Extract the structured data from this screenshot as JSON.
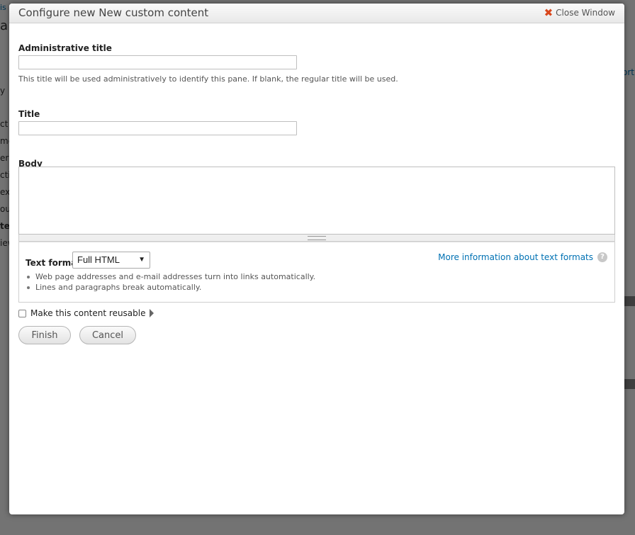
{
  "background": {
    "fragments": [
      "is",
      "a",
      "ort",
      "y",
      "ct",
      "me",
      "era",
      "cti",
      "ex",
      "out",
      "ter",
      "iew"
    ]
  },
  "modal": {
    "title": "Configure new New custom content",
    "close_label": "Close Window",
    "admin_title": {
      "label": "Administrative title",
      "value": "",
      "description": "This title will be used administratively to identify this pane. If blank, the regular title will be used."
    },
    "title_field": {
      "label": "Title",
      "value": ""
    },
    "body": {
      "label": "Body",
      "value": ""
    },
    "text_format": {
      "label": "Text format",
      "selected": "Full HTML",
      "more_info": "More information about text formats",
      "tips": [
        "Web page addresses and e-mail addresses turn into links automatically.",
        "Lines and paragraphs break automatically."
      ]
    },
    "reusable": {
      "label": "Make this content reusable",
      "checked": false
    },
    "buttons": {
      "finish": "Finish",
      "cancel": "Cancel"
    }
  },
  "colors": {
    "link": "#0071b3",
    "close_icon": "#d9471c",
    "overlay": "#6b6b6b"
  }
}
